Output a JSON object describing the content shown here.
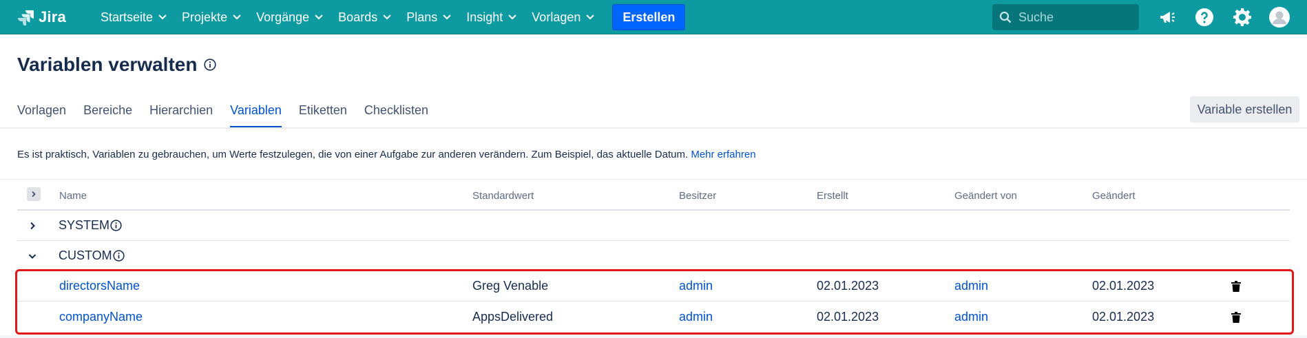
{
  "app": {
    "logo_text": "Jira"
  },
  "nav": {
    "items": [
      {
        "label": "Startseite"
      },
      {
        "label": "Projekte"
      },
      {
        "label": "Vorgänge"
      },
      {
        "label": "Boards"
      },
      {
        "label": "Plans"
      },
      {
        "label": "Insight"
      },
      {
        "label": "Vorlagen"
      }
    ],
    "create_label": "Erstellen",
    "search_placeholder": "Suche"
  },
  "page": {
    "title": "Variablen verwalten",
    "tabs": [
      {
        "label": "Vorlagen"
      },
      {
        "label": "Bereiche"
      },
      {
        "label": "Hierarchien"
      },
      {
        "label": "Variablen",
        "active": true
      },
      {
        "label": "Etiketten"
      },
      {
        "label": "Checklisten"
      }
    ],
    "create_variable_label": "Variable erstellen",
    "description": "Es ist praktisch, Variablen zu gebrauchen, um Werte festzulegen, die von einer Aufgabe zur anderen verändern. Zum Beispiel, das aktuelle Datum.",
    "learn_more_label": "Mehr erfahren"
  },
  "table": {
    "headers": {
      "name": "Name",
      "default": "Standardwert",
      "owner": "Besitzer",
      "created": "Erstellt",
      "changed_by": "Geändert von",
      "changed": "Geändert"
    },
    "groups": [
      {
        "label": "SYSTEM",
        "expanded": false
      },
      {
        "label": "CUSTOM",
        "expanded": true
      }
    ],
    "rows": [
      {
        "name": "directorsName",
        "default": "Greg Venable",
        "owner": "admin",
        "created": "02.01.2023",
        "changed_by": "admin",
        "changed": "02.01.2023"
      },
      {
        "name": "companyName",
        "default": "AppsDelivered",
        "owner": "admin",
        "created": "02.01.2023",
        "changed_by": "admin",
        "changed": "02.01.2023"
      }
    ]
  },
  "colors": {
    "topbar": "#0d9aa0",
    "create_button": "#0065ff",
    "link": "#0052cc",
    "highlight": "#e01818"
  },
  "icons": [
    "jira-logo-icon",
    "chevron-down-icon",
    "search-icon",
    "megaphone-icon",
    "help-icon",
    "gear-icon",
    "avatar-icon",
    "info-icon",
    "chevron-right-icon",
    "trash-icon"
  ]
}
